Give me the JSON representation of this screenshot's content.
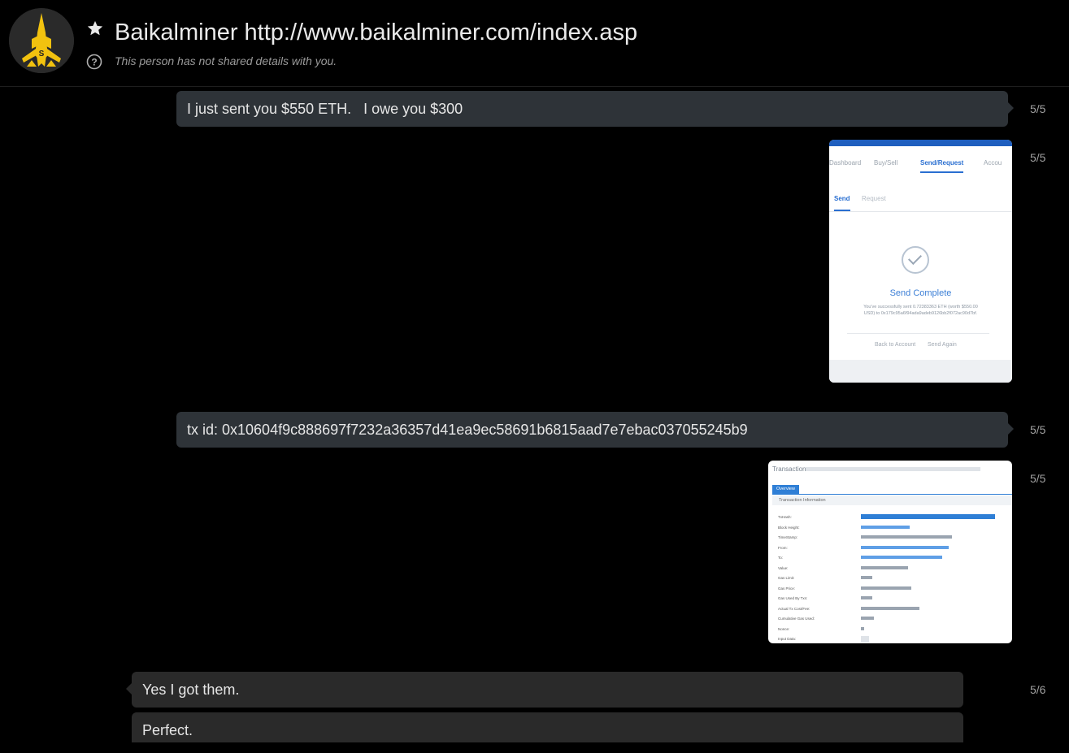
{
  "header": {
    "title": "Baikalminer http://www.baikalminer.com/index.asp",
    "subtitle": "This person has not shared details with you.",
    "avatar_letters": "SM",
    "icons": {
      "favorite": "star-icon",
      "info": "question-circle-icon"
    }
  },
  "messages": [
    {
      "type": "text",
      "direction": "sent",
      "text": "I just sent you $550 ETH.   I owe you $300",
      "time": "5/5"
    },
    {
      "type": "image",
      "direction": "sent",
      "time": "5/5",
      "image": {
        "nav": [
          "Dashboard",
          "Buy/Sell",
          "Send/Request",
          "Accou"
        ],
        "tabs": [
          "Send",
          "Request"
        ],
        "heading": "Send Complete",
        "lines": [
          "You've successfully sent 0.72383363 ETH (worth $550.00",
          "USD) to 0x179c95a6f94ada9adeb9126bb2f072ac90d7bf."
        ],
        "links": [
          "Back to Account",
          "Send Again"
        ]
      }
    },
    {
      "type": "text",
      "direction": "sent",
      "text": "tx id: 0x10604f9c888697f7232a36357d41ea9ec58691b6815aad7e7ebac037055245b9",
      "time": "5/5"
    },
    {
      "type": "image",
      "direction": "sent",
      "time": "5/5",
      "image": {
        "heading": "Transaction",
        "tab": "Overview",
        "section": "Transaction Information",
        "rows": [
          "TxHash:",
          "Block Height:",
          "TimeStamp:",
          "From:",
          "To:",
          "Value:",
          "Gas Limit:",
          "Gas Price:",
          "Gas Used By Txn:",
          "Actual Tx Cost/Fee:",
          "Cumulative Gas Used:",
          "Nonce:",
          "Input Data:"
        ]
      }
    },
    {
      "type": "text",
      "direction": "received",
      "text": "Yes I got them.",
      "time": "5/6"
    },
    {
      "type": "text",
      "direction": "received",
      "text": "Perfect.",
      "time": ""
    }
  ],
  "colors": {
    "sent_bubble": "#2e3338",
    "received_bubble": "#2a2a2a",
    "background": "#000000",
    "avatar_accent": "#f2c20f"
  }
}
